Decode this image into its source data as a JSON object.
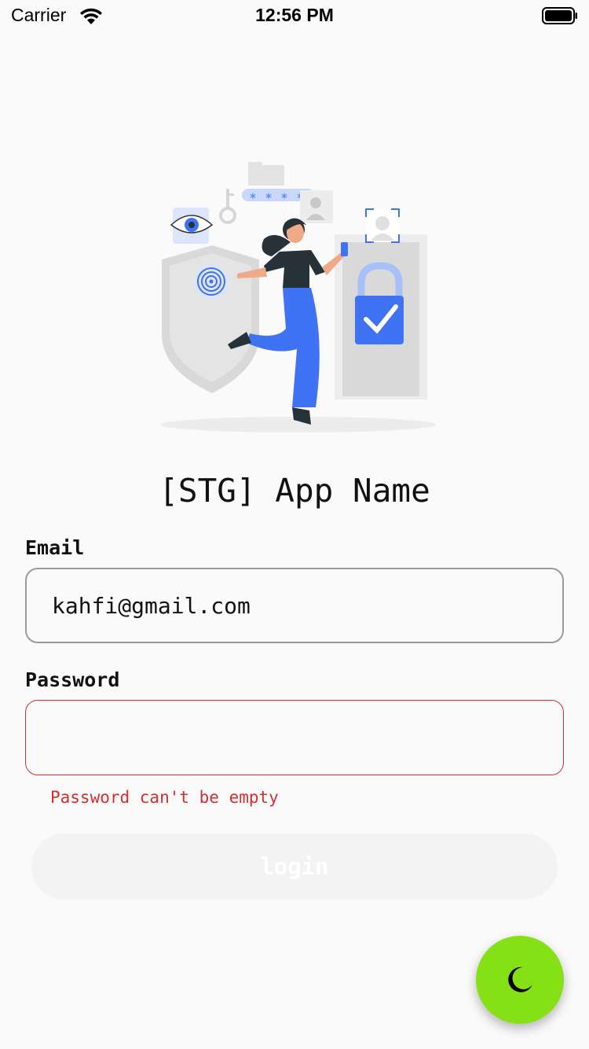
{
  "status_bar": {
    "carrier": "Carrier",
    "time": "12:56 PM"
  },
  "app": {
    "title": "[STG] App Name"
  },
  "form": {
    "email": {
      "label": "Email",
      "value": "kahfi@gmail.com"
    },
    "password": {
      "label": "Password",
      "value": "",
      "error": "Password can't be empty"
    },
    "login_label": "login"
  },
  "theme": {
    "accent": "#85e116",
    "error": "#d32f2f",
    "illustration_blue": "#3f73f4"
  },
  "icons": {
    "fab": "moon-icon",
    "illustration": "security-login-illustration"
  }
}
